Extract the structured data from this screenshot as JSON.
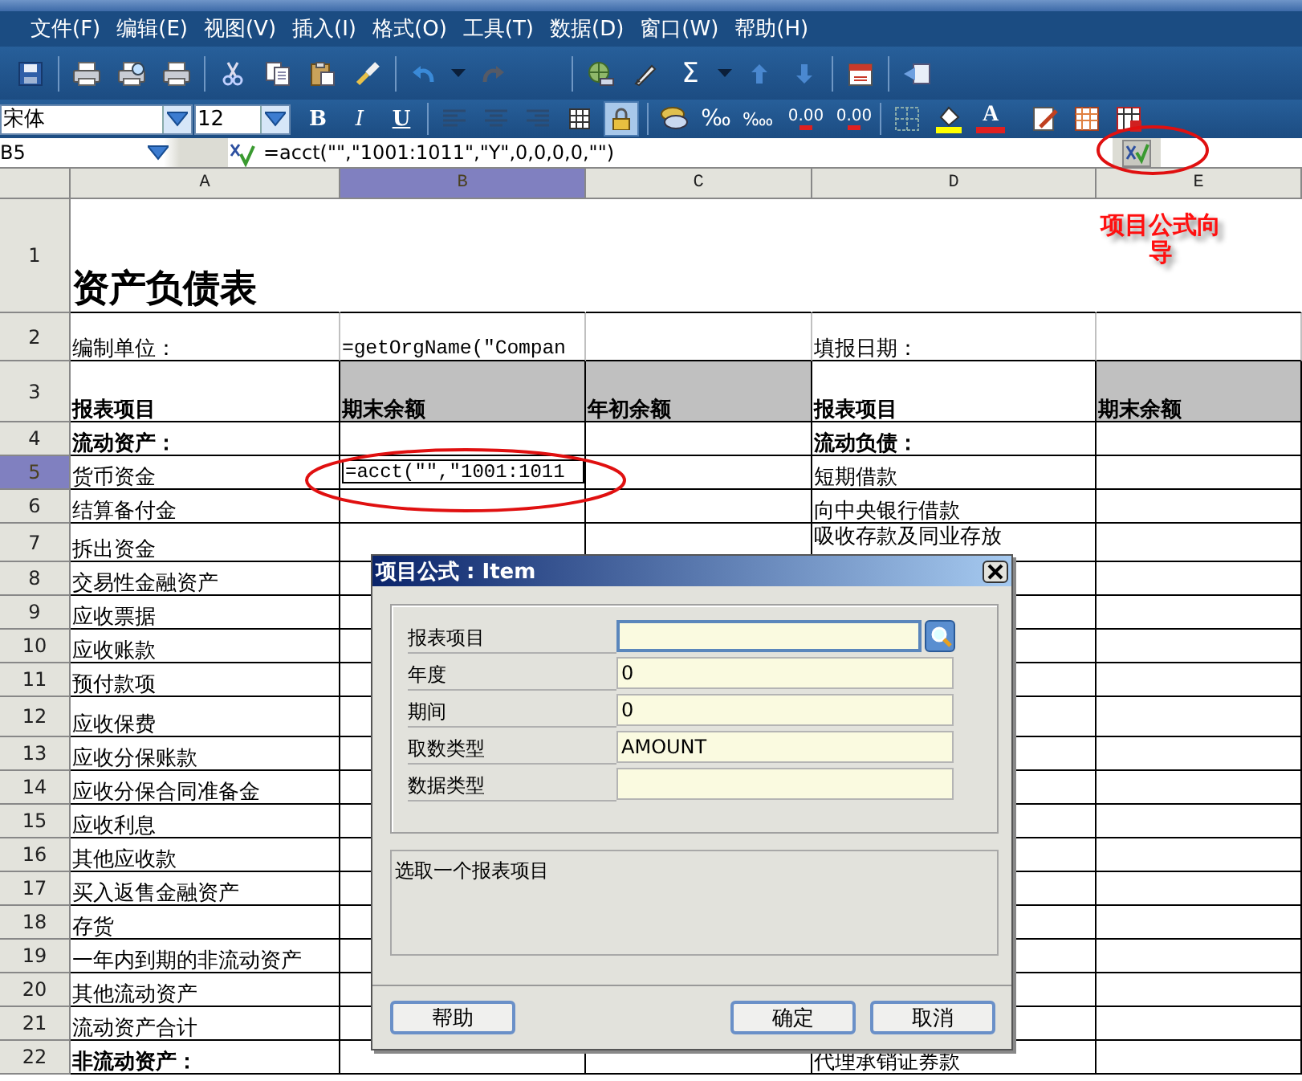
{
  "menu": [
    {
      "label": "文件(F)"
    },
    {
      "label": "编辑(E)"
    },
    {
      "label": "视图(V)"
    },
    {
      "label": "插入(I)"
    },
    {
      "label": "格式(O)"
    },
    {
      "label": "工具(T)"
    },
    {
      "label": "数据(D)"
    },
    {
      "label": "窗口(W)"
    },
    {
      "label": "帮助(H)"
    }
  ],
  "standard_toolbar": {
    "sum": "Σ"
  },
  "format_toolbar": {
    "font": "宋体",
    "size": "12",
    "bold": "B",
    "italic": "I",
    "underline": "U",
    "lock_on": true,
    "permille": "‰",
    "per_ten_thousand": "‱",
    "add_decimal": "0.00",
    "remove_decimal": "0.00",
    "font_color": "A"
  },
  "formula_bar": {
    "cell_ref": "B5",
    "formula": "=acct(\"\",\"1001:1011\",\"Y\",0,0,0,0,\"\")"
  },
  "sheet": {
    "columns": [
      {
        "label": "A",
        "selected": false
      },
      {
        "label": "B",
        "selected": true
      },
      {
        "label": "C",
        "selected": false
      },
      {
        "label": "D",
        "selected": false
      },
      {
        "label": "E",
        "selected": false
      }
    ],
    "rows": [
      {
        "number": "1",
        "selected": false,
        "cells": {
          "A": {
            "text": "资产负债表",
            "kind": "title"
          }
        }
      },
      {
        "number": "2",
        "selected": false,
        "cells": {
          "A": {
            "text": "编制单位："
          },
          "B": {
            "text": "=getOrgName(\"Compan",
            "kind": "formula"
          },
          "D": {
            "text": "填报日期："
          }
        }
      },
      {
        "number": "3",
        "selected": false,
        "cells": {
          "A": {
            "text": "报表项目",
            "kind": "heading"
          },
          "B": {
            "text": "期末余额",
            "kind": "heading",
            "shaded": true
          },
          "C": {
            "text": "年初余额",
            "kind": "heading",
            "shaded": true
          },
          "D": {
            "text": "报表项目",
            "kind": "heading"
          },
          "E": {
            "text": "期末余额",
            "kind": "heading",
            "shaded": true
          }
        }
      },
      {
        "number": "4",
        "selected": false,
        "cells": {
          "A": {
            "text": "流动资产：",
            "kind": "heading"
          },
          "D": {
            "text": "流动负债：",
            "kind": "heading"
          }
        }
      },
      {
        "number": "5",
        "selected": true,
        "cells": {
          "A": {
            "text": "货币资金"
          },
          "B": {
            "text": "=acct(\"\",\"1001:1011",
            "kind": "formula",
            "editing": true
          },
          "D": {
            "text": "短期借款"
          }
        }
      },
      {
        "number": "6",
        "selected": false,
        "cells": {
          "A": {
            "text": "结算备付金"
          },
          "D": {
            "text": "向中央银行借款"
          }
        }
      },
      {
        "number": "7",
        "selected": false,
        "cells": {
          "A": {
            "text": "拆出资金"
          },
          "D": {
            "text": "吸收存款及同业存放"
          }
        }
      },
      {
        "number": "8",
        "selected": false,
        "cells": {
          "A": {
            "text": "交易性金融资产"
          }
        }
      },
      {
        "number": "9",
        "selected": false,
        "cells": {
          "A": {
            "text": "应收票据"
          }
        }
      },
      {
        "number": "10",
        "selected": false,
        "cells": {
          "A": {
            "text": "应收账款"
          }
        }
      },
      {
        "number": "11",
        "selected": false,
        "cells": {
          "A": {
            "text": "预付款项"
          }
        }
      },
      {
        "number": "12",
        "selected": false,
        "cells": {
          "A": {
            "text": "应收保费"
          }
        }
      },
      {
        "number": "13",
        "selected": false,
        "cells": {
          "A": {
            "text": "应收分保账款"
          }
        }
      },
      {
        "number": "14",
        "selected": false,
        "cells": {
          "A": {
            "text": "应收分保合同准备金"
          }
        }
      },
      {
        "number": "15",
        "selected": false,
        "cells": {
          "A": {
            "text": "应收利息"
          }
        }
      },
      {
        "number": "16",
        "selected": false,
        "cells": {
          "A": {
            "text": "其他应收款"
          }
        }
      },
      {
        "number": "17",
        "selected": false,
        "cells": {
          "A": {
            "text": "买入返售金融资产"
          }
        }
      },
      {
        "number": "18",
        "selected": false,
        "cells": {
          "A": {
            "text": "存货"
          }
        }
      },
      {
        "number": "19",
        "selected": false,
        "cells": {
          "A": {
            "text": "一年内到期的非流动资产"
          }
        }
      },
      {
        "number": "20",
        "selected": false,
        "cells": {
          "A": {
            "text": "其他流动资产"
          }
        }
      },
      {
        "number": "21",
        "selected": false,
        "cells": {
          "A": {
            "text": "流动资产合计"
          }
        }
      },
      {
        "number": "22",
        "selected": false,
        "cells": {
          "A": {
            "text": "非流动资产：",
            "kind": "heading"
          },
          "D": {
            "text": "代理承销证券款"
          }
        }
      }
    ]
  },
  "annotation": {
    "text": "项目公式向导"
  },
  "dialog": {
    "title": "项目公式 : Item",
    "fields": [
      {
        "label": "报表项目",
        "kind": "lookup",
        "focused": true
      },
      {
        "label": "年度",
        "kind": "text",
        "focused": false,
        "value": "0"
      },
      {
        "label": "期间",
        "kind": "text",
        "focused": false,
        "value": "0"
      },
      {
        "label": "取数类型",
        "kind": "text",
        "focused": false,
        "value": "AMOUNT"
      },
      {
        "label": "数据类型",
        "kind": "text",
        "focused": false
      }
    ],
    "hint": "选取一个报表项目",
    "buttons": [
      {
        "label": "帮助"
      },
      {
        "label": "确定"
      },
      {
        "label": "取消"
      }
    ]
  }
}
